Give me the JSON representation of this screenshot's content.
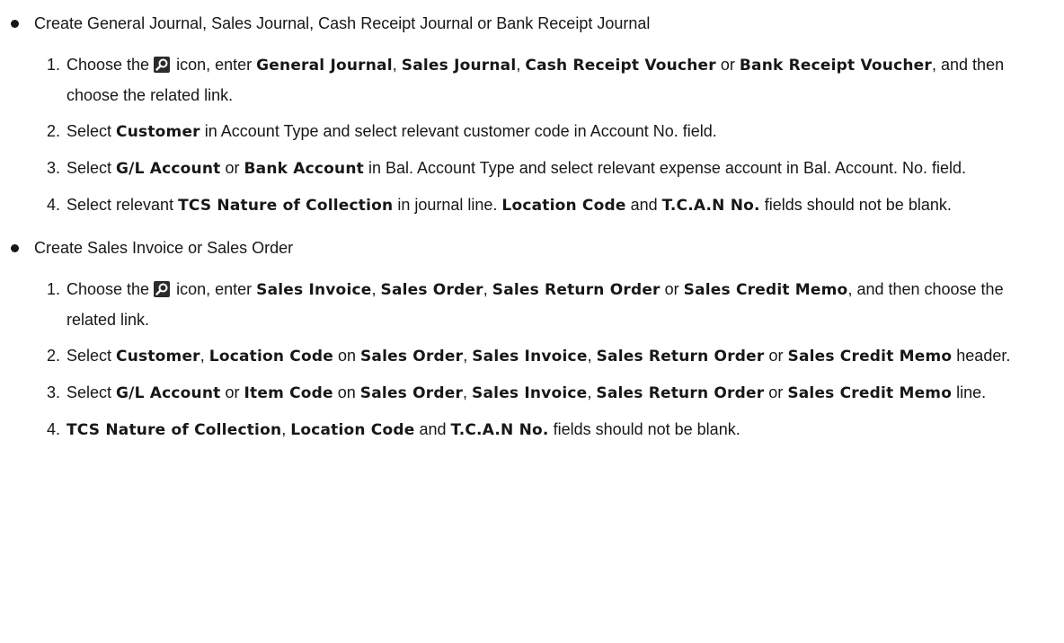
{
  "sections": [
    {
      "heading": "Create General Journal, Sales Journal, Cash Receipt Journal or Bank Receipt Journal",
      "steps": [
        {
          "num": "1.",
          "parts": [
            {
              "t": "Choose the "
            },
            {
              "icon": "search-icon"
            },
            {
              "t": " icon, enter "
            },
            {
              "b": "General Journal"
            },
            {
              "t": ", "
            },
            {
              "b": "Sales Journal"
            },
            {
              "t": ", "
            },
            {
              "b": "Cash Receipt Voucher"
            },
            {
              "t": " or "
            },
            {
              "b": "Bank Receipt Voucher"
            },
            {
              "t": ", and then choose the related link."
            }
          ]
        },
        {
          "num": "2.",
          "parts": [
            {
              "t": "Select "
            },
            {
              "b": "Customer"
            },
            {
              "t": " in Account Type and select relevant customer code in Account No. field."
            }
          ]
        },
        {
          "num": "3.",
          "parts": [
            {
              "t": "Select "
            },
            {
              "b": "G/L Account"
            },
            {
              "t": " or "
            },
            {
              "b": "Bank Account"
            },
            {
              "t": " in Bal. Account Type and select relevant expense account in Bal. Account. No. field."
            }
          ]
        },
        {
          "num": "4.",
          "parts": [
            {
              "t": "Select relevant "
            },
            {
              "b": "TCS Nature of Collection"
            },
            {
              "t": " in journal line. "
            },
            {
              "b": "Location Code"
            },
            {
              "t": " and "
            },
            {
              "b": "T.C.A.N No."
            },
            {
              "t": " fields should not be blank."
            }
          ]
        }
      ]
    },
    {
      "heading": "Create Sales Invoice or Sales Order",
      "steps": [
        {
          "num": "1.",
          "parts": [
            {
              "t": "Choose the "
            },
            {
              "icon": "search-icon"
            },
            {
              "t": " icon, enter "
            },
            {
              "b": "Sales Invoice"
            },
            {
              "t": ", "
            },
            {
              "b": "Sales Order"
            },
            {
              "t": ", "
            },
            {
              "b": "Sales Return Order"
            },
            {
              "t": " or "
            },
            {
              "b": "Sales Credit Memo"
            },
            {
              "t": ", and then choose the related link."
            }
          ]
        },
        {
          "num": "2.",
          "parts": [
            {
              "t": "Select "
            },
            {
              "b": "Customer"
            },
            {
              "t": ", "
            },
            {
              "b": "Location Code"
            },
            {
              "t": " on "
            },
            {
              "b": "Sales Order"
            },
            {
              "t": ", "
            },
            {
              "b": "Sales Invoice"
            },
            {
              "t": ", "
            },
            {
              "b": "Sales Return Order"
            },
            {
              "t": " or "
            },
            {
              "b": "Sales Credit Memo"
            },
            {
              "t": " header."
            }
          ]
        },
        {
          "num": "3.",
          "parts": [
            {
              "t": "Select "
            },
            {
              "b": "G/L Account"
            },
            {
              "t": " or "
            },
            {
              "b": "Item Code"
            },
            {
              "t": " on "
            },
            {
              "b": "Sales Order"
            },
            {
              "t": ", "
            },
            {
              "b": "Sales Invoice"
            },
            {
              "t": ", "
            },
            {
              "b": "Sales Return Order"
            },
            {
              "t": " or "
            },
            {
              "b": "Sales Credit Memo"
            },
            {
              "t": " line."
            }
          ]
        },
        {
          "num": "4.",
          "parts": [
            {
              "b": "TCS Nature of Collection"
            },
            {
              "t": ", "
            },
            {
              "b": "Location Code"
            },
            {
              "t": " and "
            },
            {
              "b": "T.C.A.N No."
            },
            {
              "t": " fields should not be blank."
            }
          ]
        }
      ]
    }
  ]
}
